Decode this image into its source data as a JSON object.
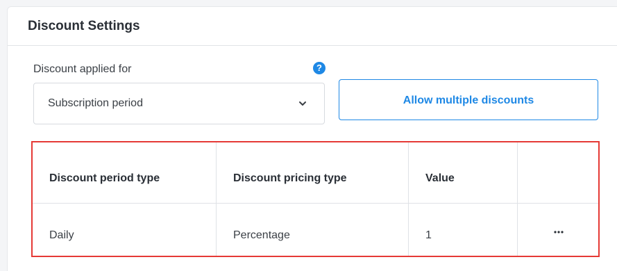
{
  "panel": {
    "title": "Discount Settings"
  },
  "form": {
    "discount_applied_for": {
      "label": "Discount applied for",
      "value": "Subscription period",
      "help_icon": "?"
    },
    "allow_multiple_button": "Allow multiple discounts"
  },
  "table": {
    "columns": [
      "Discount period type",
      "Discount pricing type",
      "Value",
      ""
    ],
    "rows": [
      {
        "period_type": "Daily",
        "pricing_type": "Percentage",
        "value": "1",
        "actions_icon": "more-horizontal-icon"
      }
    ],
    "highlight_color": "#e53935"
  },
  "colors": {
    "accent": "#1e88e5",
    "text": "#3a3f45"
  }
}
